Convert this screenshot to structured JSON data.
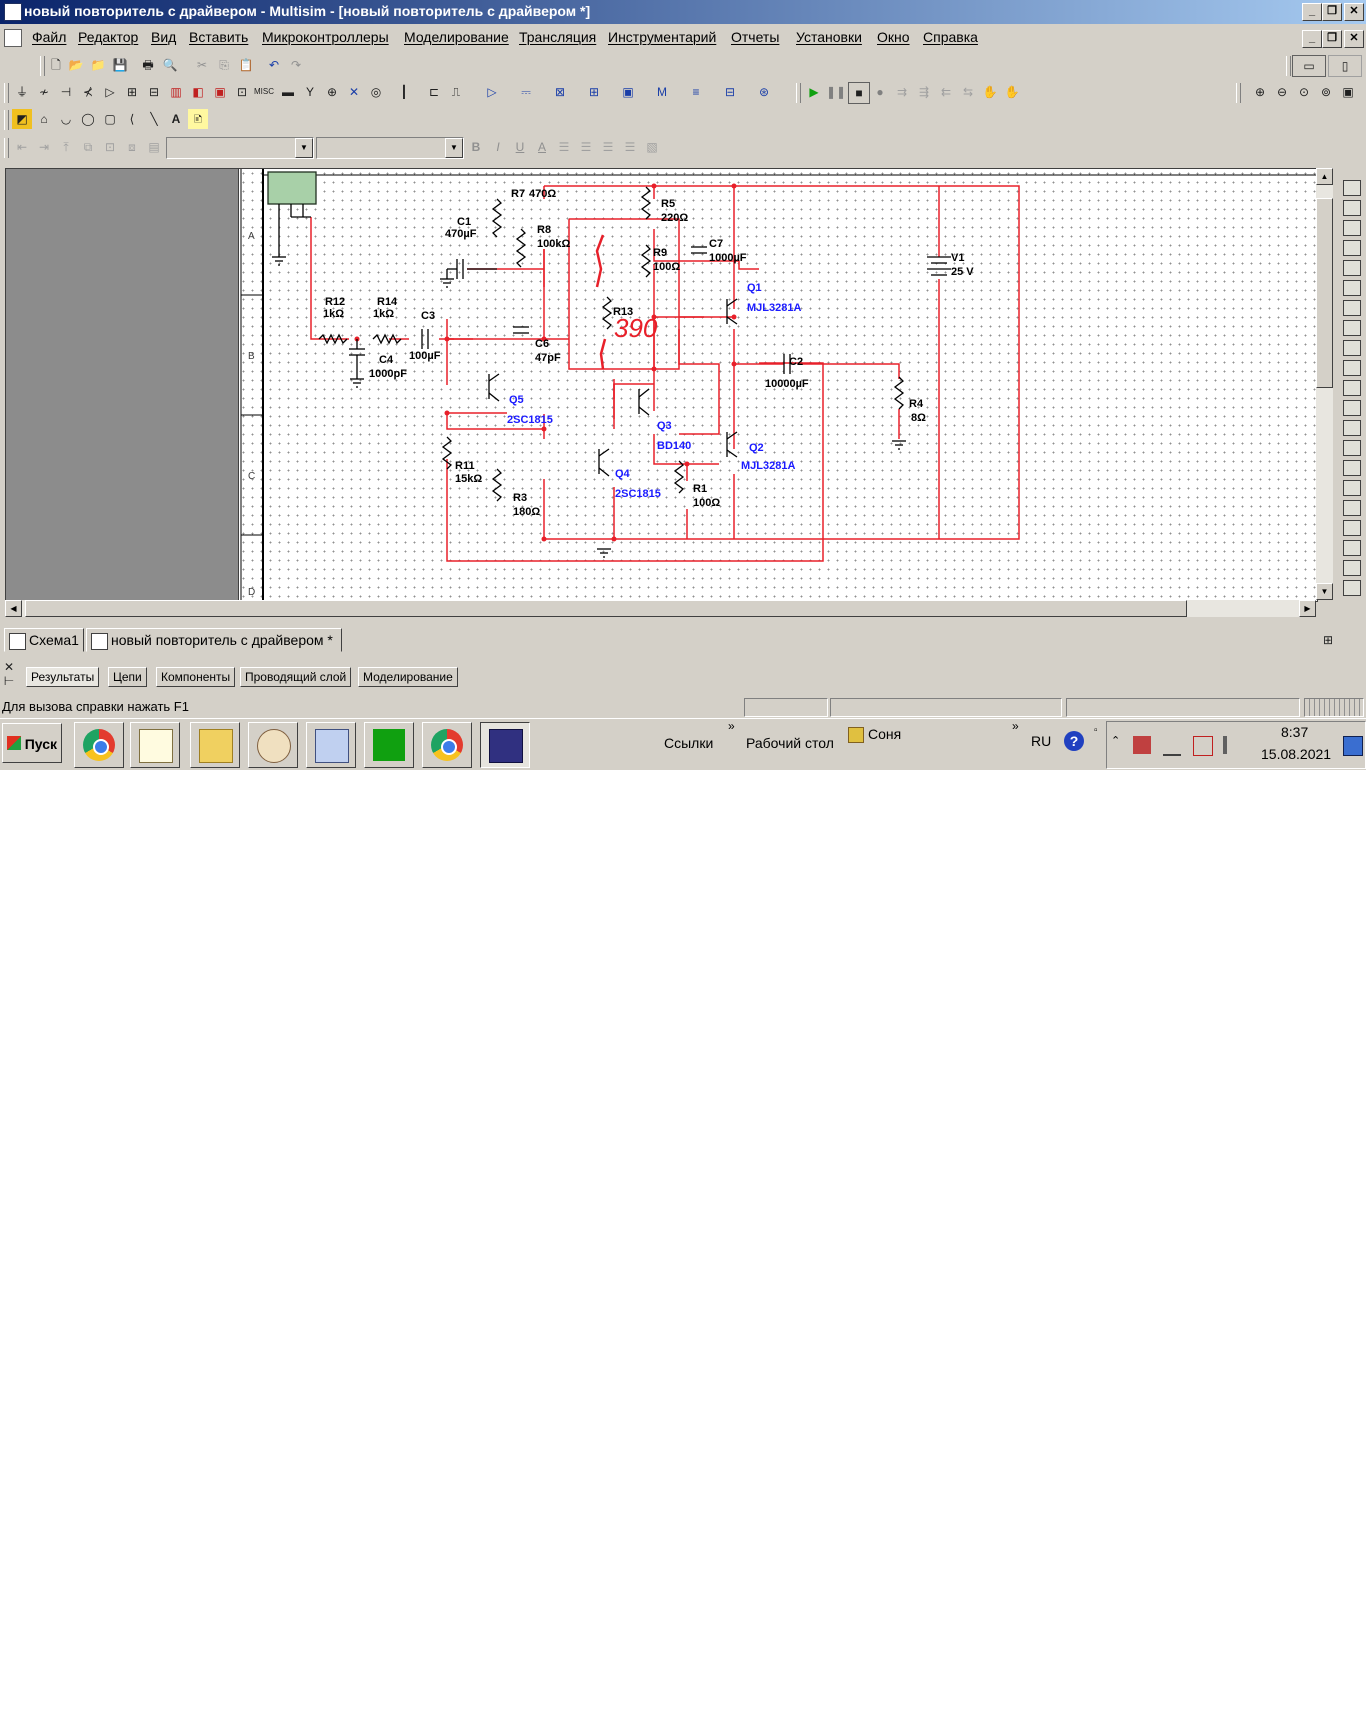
{
  "window": {
    "title": "новый повторитель с драйвером - Multisim - [новый повторитель с драйвером *]",
    "controls": [
      "_",
      "❐",
      "✕"
    ]
  },
  "menu": [
    "Файл",
    "Редактор",
    "Вид",
    "Вставить",
    "Микроконтроллеры",
    "Моделирование",
    "Трансляция",
    "Инструментарий",
    "Отчеты",
    "Установки",
    "Окно",
    "Справка"
  ],
  "toolbar": {
    "text_style_buttons": [
      "B",
      "I",
      "U",
      "A"
    ],
    "draw_text_tool": "A"
  },
  "schematic": {
    "labels": {
      "r7": "R7",
      "r7v": "470Ω",
      "c1": "C1",
      "c1v": "470µF",
      "r8": "R8",
      "r8v": "100kΩ",
      "r5": "R5",
      "r5v": "220Ω",
      "r9": "R9",
      "r9v": "100Ω",
      "c7": "C7",
      "c7v": "1000µF",
      "v1": "V1",
      "v1v": "25 V",
      "r12": "R12",
      "r12v": "1kΩ",
      "r14": "R14",
      "r14v": "1kΩ",
      "c3": "C3",
      "c3v": "100µF",
      "c4": "C4",
      "c4v": "1000pF",
      "c6": "C6",
      "c6v": "47pF",
      "r13": "R13",
      "q1": "Q1",
      "q1v": "MJL3281A",
      "c2": "C2",
      "c2v": "10000µF",
      "q5": "Q5",
      "q5v": "2SC1815",
      "q3": "Q3",
      "q3v": "BD140",
      "q2": "Q2",
      "q2v": "MJL3281A",
      "r4": "R4",
      "r4v": "8Ω",
      "r11": "R11",
      "r11v": "15kΩ",
      "q4": "Q4",
      "q4v": "2SC1815",
      "r1": "R1",
      "r1v": "100Ω",
      "r3": "R3",
      "r3v": "180Ω",
      "handwritten": "390",
      "rows": [
        "A",
        "B",
        "C",
        "D"
      ]
    },
    "wire_color": "#e8202a",
    "label_color_blue": "#1a1aff"
  },
  "tabs": [
    "Схема1",
    "новый повторитель с драйвером *"
  ],
  "output_tabs": [
    "Результаты",
    "Цепи",
    "Компоненты",
    "Проводящий слой",
    "Моделирование"
  ],
  "status": "Для вызова справки нажать F1",
  "taskbar": {
    "start": "Пуск",
    "links": "Ссылки",
    "desktop": "Рабочий стол",
    "user": "Соня",
    "chevron": "»",
    "lang": "RU",
    "time": "8:37",
    "date": "15.08.2021"
  }
}
